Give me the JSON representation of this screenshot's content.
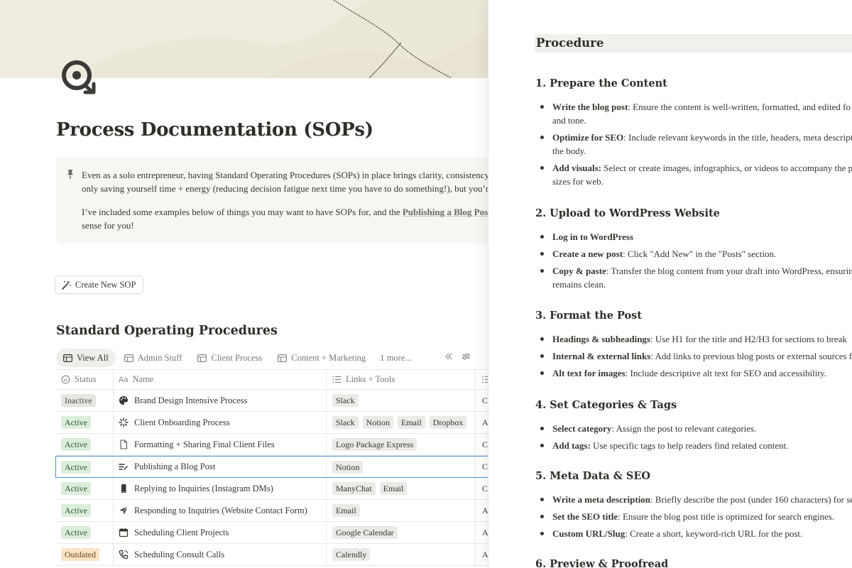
{
  "page": {
    "title": "Process Documentation (SOPs)",
    "callout": {
      "p1_line1": "Even as a solo entrepreneur, having Standard Operating Procedures (SOPs) in place brings clarity, consistency,",
      "p1_line2": "only saving yourself time + energy (reducing decision fatigue next time you have to do something!), but you’re",
      "p2_before": "I’ve included some examples below of things you may want to have SOPs for, and the ",
      "p2_link": "Publishing a Blog Post",
      "p2_line2": "sense for you!"
    },
    "create_button": "Create New SOP"
  },
  "database": {
    "title": "Standard Operating Procedures",
    "views": [
      {
        "label": "View All",
        "active": true
      },
      {
        "label": "Admin Stuff",
        "active": false
      },
      {
        "label": "Client Process",
        "active": false
      },
      {
        "label": "Content + Marketing",
        "active": false
      }
    ],
    "more_views": "1 more...",
    "headers": {
      "status": "Status",
      "name": "Name",
      "links": "Links + Tools"
    },
    "rows": [
      {
        "status": "Inactive",
        "status_kind": "inactive",
        "name": "Brand Design Intensive Process",
        "icon": "palette-icon",
        "links": [
          "Slack"
        ],
        "extra": "C"
      },
      {
        "status": "Active",
        "status_kind": "active",
        "name": "Client Onboarding Process",
        "icon": "sparkle-icon",
        "links": [
          "Slack",
          "Notion",
          "Email",
          "Dropbox"
        ],
        "extra": "A"
      },
      {
        "status": "Active",
        "status_kind": "active",
        "name": "Formatting + Sharing Final Client Files",
        "icon": "document-icon",
        "links": [
          "Logo Package Express"
        ],
        "extra": "C"
      },
      {
        "status": "Active",
        "status_kind": "active",
        "name": "Publishing a Blog Post",
        "icon": "edit-list-icon",
        "links": [
          "Notion"
        ],
        "extra": "C",
        "selected": true
      },
      {
        "status": "Active",
        "status_kind": "active",
        "name": "Replying to Inquiries (Instagram DMs)",
        "icon": "phone-icon",
        "links": [
          "ManyChat",
          "Email"
        ],
        "extra": "C"
      },
      {
        "status": "Active",
        "status_kind": "active",
        "name": "Responding to Inquiries (Website Contact Form)",
        "icon": "send-icon",
        "links": [
          "Email"
        ],
        "extra": "A"
      },
      {
        "status": "Active",
        "status_kind": "active",
        "name": "Scheduling Client Projects",
        "icon": "calendar-icon",
        "links": [
          "Google Calendar"
        ],
        "extra": "A"
      },
      {
        "status": "Outdated",
        "status_kind": "outdated",
        "name": "Scheduling Consult Calls",
        "icon": "call-icon",
        "links": [
          "Calendly"
        ],
        "extra": "A"
      }
    ]
  },
  "panel": {
    "heading": "Procedure",
    "sections": [
      {
        "title": "1. Prepare the Content",
        "items": [
          {
            "bold": "Write the blog post",
            "text": ": Ensure the content is well-written, formatted, and edited fo",
            "cont": "and tone."
          },
          {
            "bold": "Optimize for SEO",
            "text": ": Include relevant keywords in the title, headers, meta descript",
            "cont": "the body."
          },
          {
            "bold": "Add visuals:",
            "text": " Select or create images, infographics, or videos to accompany the po",
            "cont": "sizes for web."
          }
        ]
      },
      {
        "title": "2. Upload to WordPress Website",
        "items": [
          {
            "bold": "Log in to WordPress",
            "text": "",
            "cont": ""
          },
          {
            "bold": "Create a new post",
            "text": ": Click \"Add New\" in the \"Posts\" section.",
            "cont": ""
          },
          {
            "bold": "Copy & paste",
            "text": ": Transfer the blog content from your draft into WordPress, ensurin",
            "cont": "remains clean."
          }
        ]
      },
      {
        "title": "3. Format the Post",
        "items": [
          {
            "bold": "Headings & subheadings",
            "text": ": Use H1 for the title and H2/H3 for sections to break",
            "cont": ""
          },
          {
            "bold": "Internal & external links",
            "text": ": Add links to previous blog posts or external sources fo",
            "cont": ""
          },
          {
            "bold": "Alt text for images",
            "text": ": Include descriptive alt text for SEO and accessibility.",
            "cont": ""
          }
        ]
      },
      {
        "title": "4. Set Categories & Tags",
        "items": [
          {
            "bold": "Select category",
            "text": ": Assign the post to relevant categories.",
            "cont": ""
          },
          {
            "bold": "Add tags:",
            "text": " Use specific tags to help readers find related content.",
            "cont": ""
          }
        ]
      },
      {
        "title": "5. Meta Data & SEO",
        "items": [
          {
            "bold": "Write a meta description",
            "text": ": Briefly describe the post (under 160 characters) for se",
            "cont": ""
          },
          {
            "bold": "Set the SEO title",
            "text": ": Ensure the blog post title is optimized for search engines.",
            "cont": ""
          },
          {
            "bold": "Custom URL/Slug",
            "text": ": Create a short, keyword-rich URL for the post.",
            "cont": ""
          }
        ]
      },
      {
        "title": "6. Preview & Proofread",
        "items": []
      }
    ]
  }
}
